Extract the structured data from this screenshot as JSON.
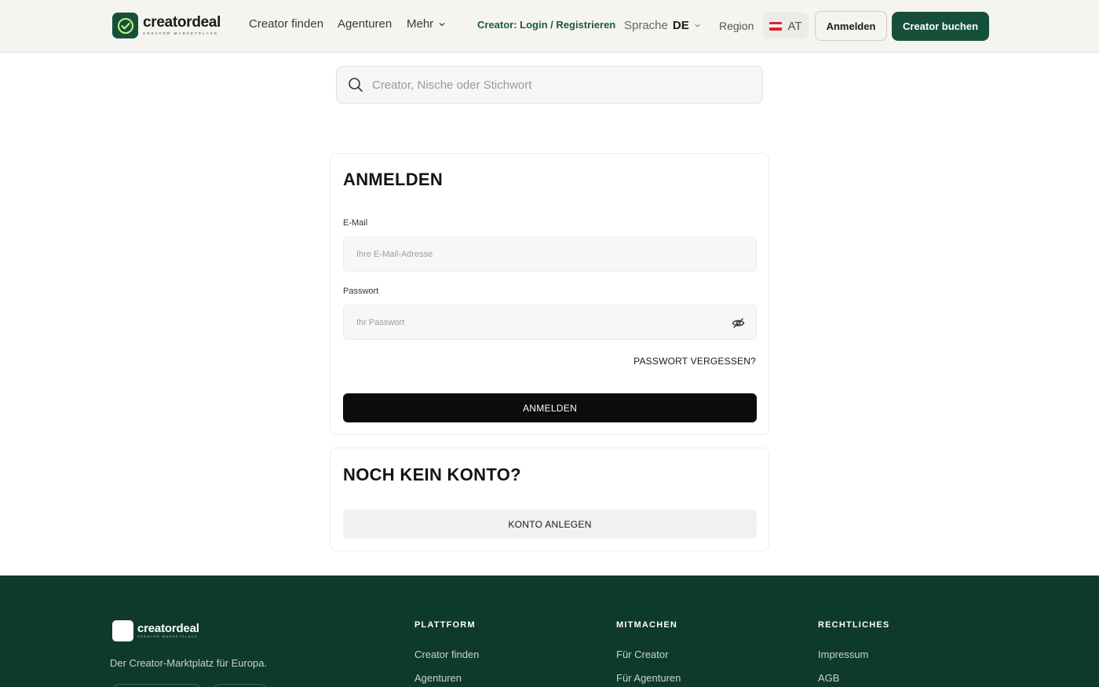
{
  "header": {
    "brand_name": "creatordeal",
    "brand_sub": "CREATOR MARKETPLACE",
    "nav": [
      {
        "label": "Creator finden"
      },
      {
        "label": "Agenturen"
      },
      {
        "label": "Mehr"
      }
    ],
    "creator_login": "Creator: Login / Registrieren",
    "language_label": "Sprache",
    "language_code": "DE",
    "region_label": "Region",
    "region_code": "AT",
    "login_button": "Anmelden",
    "book_button": "Creator buchen",
    "accent_color": "#17503a"
  },
  "search": {
    "placeholder": "Creator, Nische oder Stichwort"
  },
  "login_card": {
    "title": "ANMELDEN",
    "email_label": "E-Mail",
    "email_placeholder": "Ihre E-Mail-Adresse",
    "password_label": "Passwort",
    "password_placeholder": "Ihr Passwort",
    "forgot_link": "PASSWORT VERGESSEN?",
    "submit_label": "ANMELDEN"
  },
  "register_card": {
    "title": "NOCH KEIN KONTO?",
    "create_label": "KONTO ANLEGEN"
  },
  "footer": {
    "brand_name": "creatordeal",
    "brand_sub": "CREATOR MARKETPLACE",
    "tagline": "Der Creator-Marktplatz für Europa.",
    "columns": [
      {
        "heading": "PLATTFORM",
        "links": [
          "Creator finden",
          "Agenturen"
        ]
      },
      {
        "heading": "MITMACHEN",
        "links": [
          "Für Creator",
          "Für Agenturen"
        ]
      },
      {
        "heading": "RECHTLICHES",
        "links": [
          "Impressum",
          "AGB"
        ]
      }
    ],
    "background_color": "#0e3a2a"
  }
}
